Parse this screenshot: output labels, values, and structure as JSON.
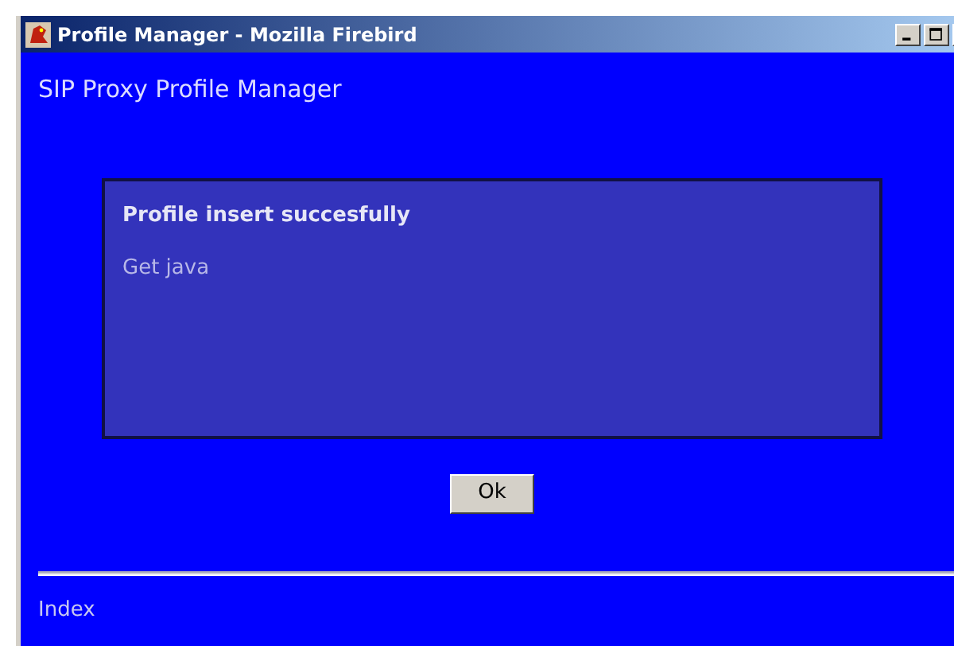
{
  "window": {
    "title": "Profile Manager - Mozilla Firebird"
  },
  "heading": "SIP Proxy Profile Manager",
  "message": {
    "title": "Profile insert succesfully",
    "link": "Get java"
  },
  "buttons": [
    "Ok"
  ],
  "footer": {
    "link": "Index"
  }
}
